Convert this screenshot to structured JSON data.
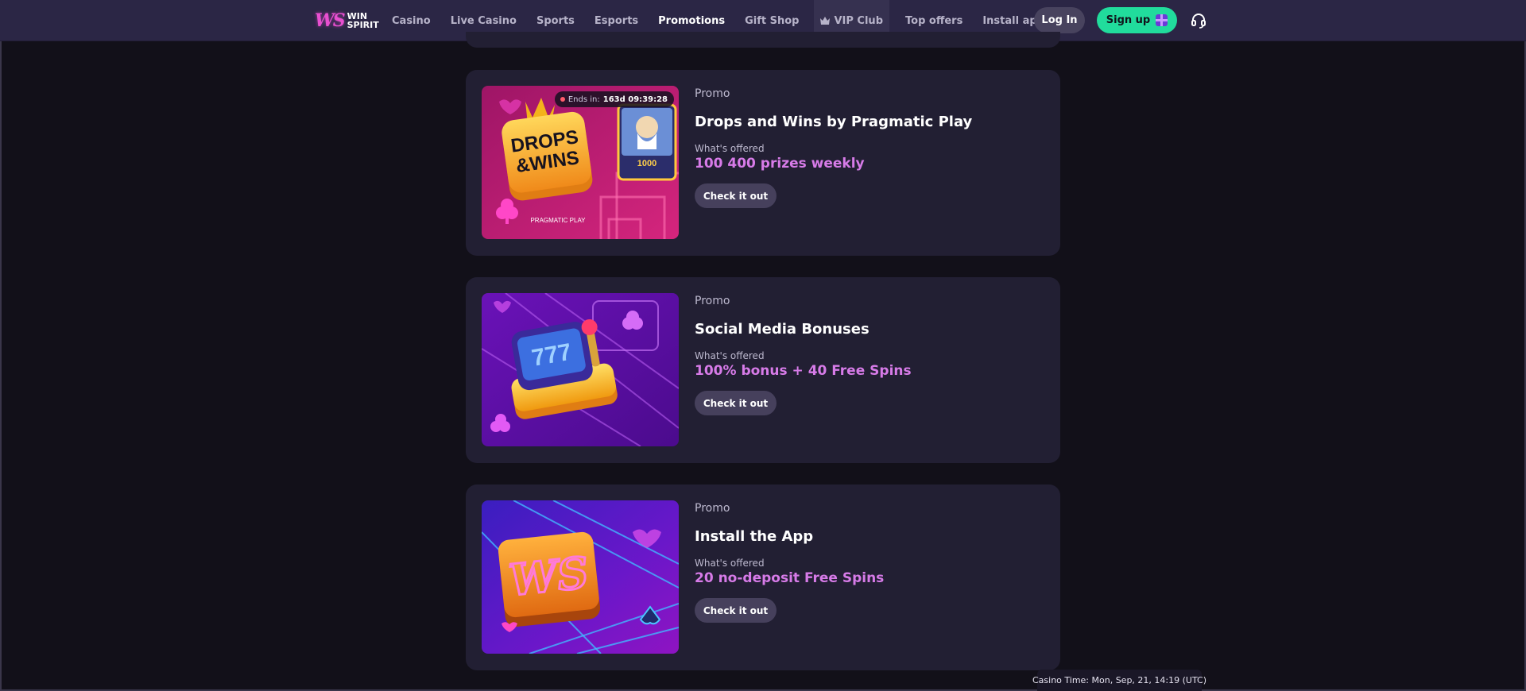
{
  "header": {
    "logo_line1": "WIN",
    "logo_line2": "SPIRIT",
    "logo_mark": "WS",
    "nav": [
      {
        "label": "Casino",
        "active": false
      },
      {
        "label": "Live Casino",
        "active": false
      },
      {
        "label": "Sports",
        "active": false
      },
      {
        "label": "Esports",
        "active": false
      },
      {
        "label": "Promotions",
        "active": true
      },
      {
        "label": "Gift Shop",
        "active": false
      }
    ],
    "vip_label": "VIP Club",
    "nav_after": [
      {
        "label": "Top offers"
      },
      {
        "label": "Install app"
      }
    ],
    "login_label": "Log In",
    "signup_label": "Sign up",
    "icons": {
      "vip": "crown-icon",
      "signup": "gift-icon",
      "support": "headset-icon"
    }
  },
  "promos": [
    {
      "tag": "Promo",
      "title": "Drops and Wins by Pragmatic Play",
      "offered_label": "What's offered",
      "offered_value": "100 400 prizes weekly",
      "button_label": "Check it out",
      "timer_label": "Ends in:",
      "timer_value": "163d 09:39:28",
      "image_text": [
        "DROPS",
        "&WINS"
      ],
      "image_provider": "PRAGMATIC PLAY",
      "image_prize": "1000"
    },
    {
      "tag": "Promo",
      "title": "Social Media Bonuses",
      "offered_label": "What's offered",
      "offered_value": "100% bonus + 40 Free Spins",
      "button_label": "Check it out"
    },
    {
      "tag": "Promo",
      "title": "Install the App",
      "offered_label": "What's offered",
      "offered_value": "20 no-deposit Free Spins",
      "button_label": "Check it out",
      "image_text": "WS"
    }
  ],
  "footer": {
    "casino_time": "Casino Time: Mon, Sep, 21, 14:19 (UTC)"
  },
  "colors": {
    "background": "#121019",
    "header": "#2b2645",
    "card": "#221f33",
    "accent_green": "#21dc9c",
    "accent_pink": "#d77be8"
  }
}
